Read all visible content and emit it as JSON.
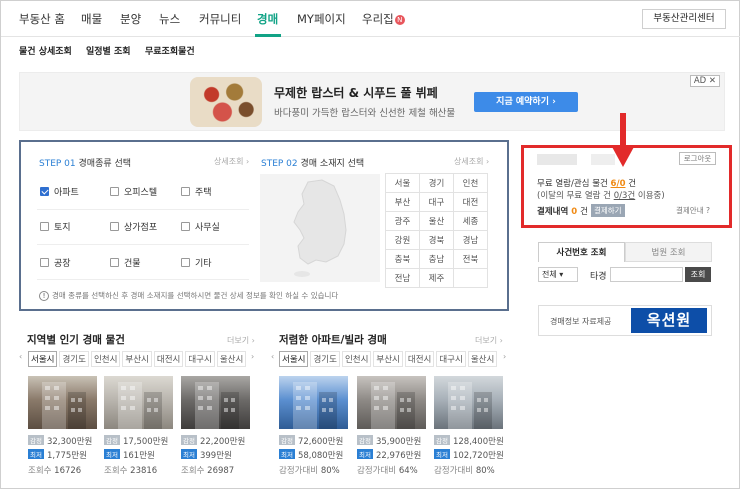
{
  "gnb": {
    "items": [
      "부동산 홈",
      "매물",
      "분양",
      "뉴스",
      "커뮤니티",
      "경매",
      "MY페이지",
      "우리집"
    ],
    "new_badge": "N",
    "center_button": "부동산관리센터"
  },
  "subnav": [
    "물건 상세조회",
    "일정별 조회",
    "무료조회물건"
  ],
  "ad": {
    "title": "무제한 랍스터 & 시푸드 풀 뷔페",
    "desc": "바다풍미 가득한 랍스터와 신선한 제철 해산물",
    "button": "지금 예약하기 ›",
    "tag": "AD ✕"
  },
  "step1": {
    "label_step": "STEP 01",
    "label_text": "경매종류 선택",
    "more": "상세조회 ›",
    "types": [
      {
        "label": "아파트",
        "checked": true
      },
      {
        "label": "오피스텔",
        "checked": false
      },
      {
        "label": "주택",
        "checked": false
      },
      {
        "label": "토지",
        "checked": false
      },
      {
        "label": "상가점포",
        "checked": false
      },
      {
        "label": "사무실",
        "checked": false
      },
      {
        "label": "공장",
        "checked": false
      },
      {
        "label": "건물",
        "checked": false
      },
      {
        "label": "기타",
        "checked": false
      }
    ]
  },
  "step2": {
    "label_step": "STEP 02",
    "label_text": "경매 소재지 선택",
    "more": "상세조회 ›",
    "regions": [
      [
        "서울",
        "경기",
        "인천"
      ],
      [
        "부산",
        "대구",
        "대전"
      ],
      [
        "광주",
        "울산",
        "세종"
      ],
      [
        "강원",
        "경북",
        "경남"
      ],
      [
        "충북",
        "충남",
        "전북"
      ],
      [
        "전남",
        "제주",
        ""
      ]
    ]
  },
  "notice": "경매 종류를 선택하신 후 경매 소재지를 선택하시면 물건 상세 정보를 확인 하실 수 있습니다",
  "login_box": {
    "logout": "로그아웃",
    "free_label": "무료 열람/관심 물건",
    "free_count": "6/0",
    "free_unit": "건",
    "monthly_text": "(이달의 무료 열람 건",
    "monthly_count": "0/3건",
    "monthly_suffix": "이용중)",
    "pay_label": "결제내역",
    "pay_count": "0",
    "pay_unit": "건",
    "pay_button": "결제하기",
    "guide": "결제안내 ?"
  },
  "case_search": {
    "tab_case": "사건번호 조회",
    "tab_court": "법원 조회",
    "select_value": "전체 ▾",
    "label": "타경",
    "button": "조회"
  },
  "banner": {
    "text": "경매정보 자료제공",
    "logo": "옥션원"
  },
  "popular": {
    "title": "지역별 인기 경매 물건",
    "more": "더보기 ›",
    "cities": [
      "서울시",
      "경기도",
      "인천시",
      "부산시",
      "대전시",
      "대구시",
      "울산시"
    ],
    "items": [
      {
        "tag1": "감정",
        "price1": "32,300만원",
        "tag2": "최저",
        "price2": "1,775만원",
        "views_label": "조회수",
        "views": "16726"
      },
      {
        "tag1": "감정",
        "price1": "17,500만원",
        "tag2": "최저",
        "price2": "161만원",
        "views_label": "조회수",
        "views": "23816"
      },
      {
        "tag1": "감정",
        "price1": "22,200만원",
        "tag2": "최저",
        "price2": "399만원",
        "views_label": "조회수",
        "views": "26987"
      }
    ]
  },
  "cheap": {
    "title": "저렴한 아파트/빌라 경매",
    "more": "더보기 ›",
    "cities": [
      "서울시",
      "경기도",
      "인천시",
      "부산시",
      "대전시",
      "대구시",
      "울산시"
    ],
    "items": [
      {
        "tag1": "감정",
        "price1": "72,600만원",
        "tag2": "최저",
        "price2": "58,080만원",
        "views_label": "감정가대비",
        "views": "80%"
      },
      {
        "tag1": "감정",
        "price1": "35,900만원",
        "tag2": "최저",
        "price2": "22,976만원",
        "views_label": "감정가대비",
        "views": "64%"
      },
      {
        "tag1": "감정",
        "price1": "128,400만원",
        "tag2": "최저",
        "price2": "102,720만원",
        "views_label": "감정가대비",
        "views": "80%"
      }
    ]
  },
  "colors": {
    "accent": "#11a386",
    "highlight_box": "#e22a2a",
    "link_blue": "#2a7fd4",
    "orange": "#f08a14"
  }
}
